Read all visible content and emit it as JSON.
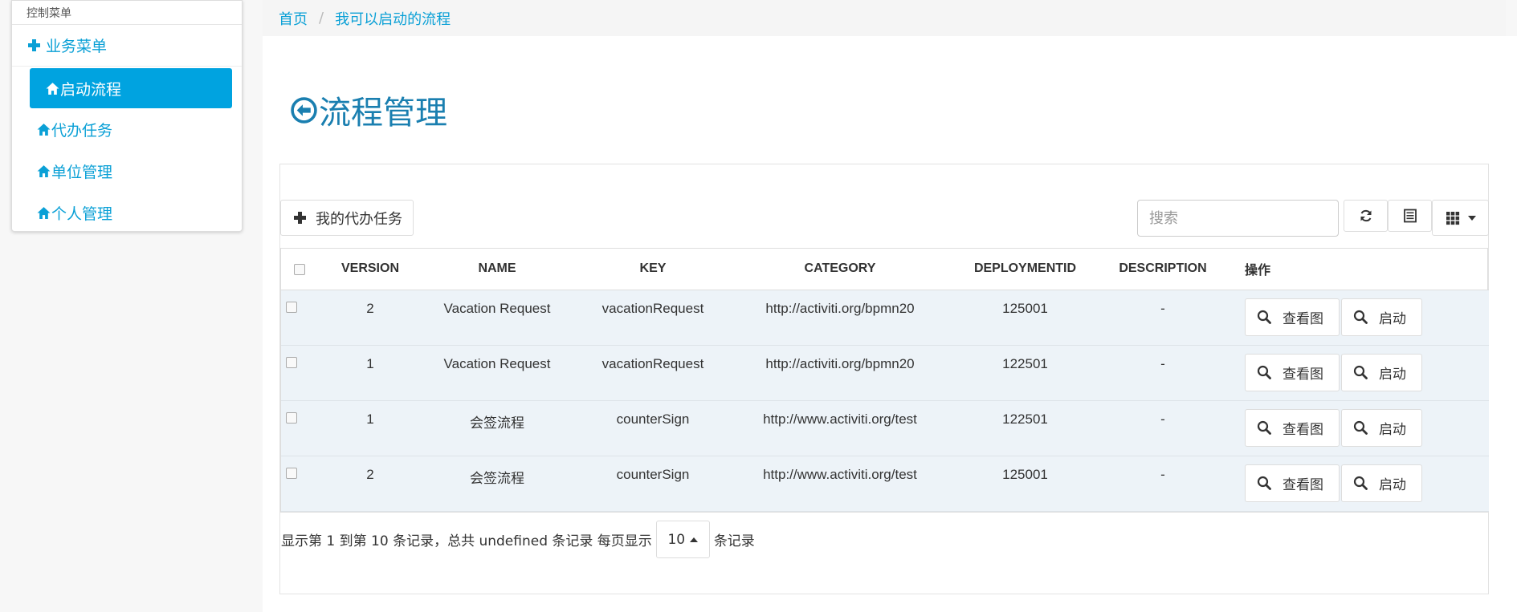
{
  "sidebar": {
    "heading": "控制菜单",
    "group_label": "业务菜单",
    "items": [
      {
        "label": "启动流程",
        "icon": "home-icon",
        "active": true
      },
      {
        "label": "代办任务",
        "icon": "home-icon",
        "active": false
      },
      {
        "label": "单位管理",
        "icon": "home-icon",
        "active": false
      },
      {
        "label": "个人管理",
        "icon": "home-icon",
        "active": false
      }
    ]
  },
  "breadcrumb": {
    "home": "首页",
    "separator": "/",
    "current": "我可以启动的流程"
  },
  "page": {
    "title": "流程管理",
    "title_icon": "circle-arrow-left-icon"
  },
  "toolbar": {
    "todo_button": "我的代办任务",
    "search_placeholder": "搜索"
  },
  "table": {
    "headers": [
      "VERSION",
      "NAME",
      "KEY",
      "CATEGORY",
      "DEPLOYMENTID",
      "DESCRIPTION",
      "操作"
    ],
    "rows": [
      {
        "version": "2",
        "name": "Vacation Request",
        "key": "vacationRequest",
        "category": "http://activiti.org/bpmn20",
        "deploymentid": "125001",
        "description": "-",
        "view_label": "查看图",
        "start_label": "启动"
      },
      {
        "version": "1",
        "name": "Vacation Request",
        "key": "vacationRequest",
        "category": "http://activiti.org/bpmn20",
        "deploymentid": "122501",
        "description": "-",
        "view_label": "查看图",
        "start_label": "启动"
      },
      {
        "version": "1",
        "name": "会签流程",
        "key": "counterSign",
        "category": "http://www.activiti.org/test",
        "deploymentid": "122501",
        "description": "-",
        "view_label": "查看图",
        "start_label": "启动"
      },
      {
        "version": "2",
        "name": "会签流程",
        "key": "counterSign",
        "category": "http://www.activiti.org/test",
        "deploymentid": "125001",
        "description": "-",
        "view_label": "查看图",
        "start_label": "启动"
      }
    ]
  },
  "pagination": {
    "info": "显示第 1 到第 10 条记录，总共 undefined 条记录 每页显示",
    "page_size": "10",
    "suffix": "条记录"
  },
  "colors": {
    "accent": "#00a3e0",
    "link": "#0aa0d6",
    "title": "#1a7fb0",
    "row_bg": "#edf3f8"
  }
}
